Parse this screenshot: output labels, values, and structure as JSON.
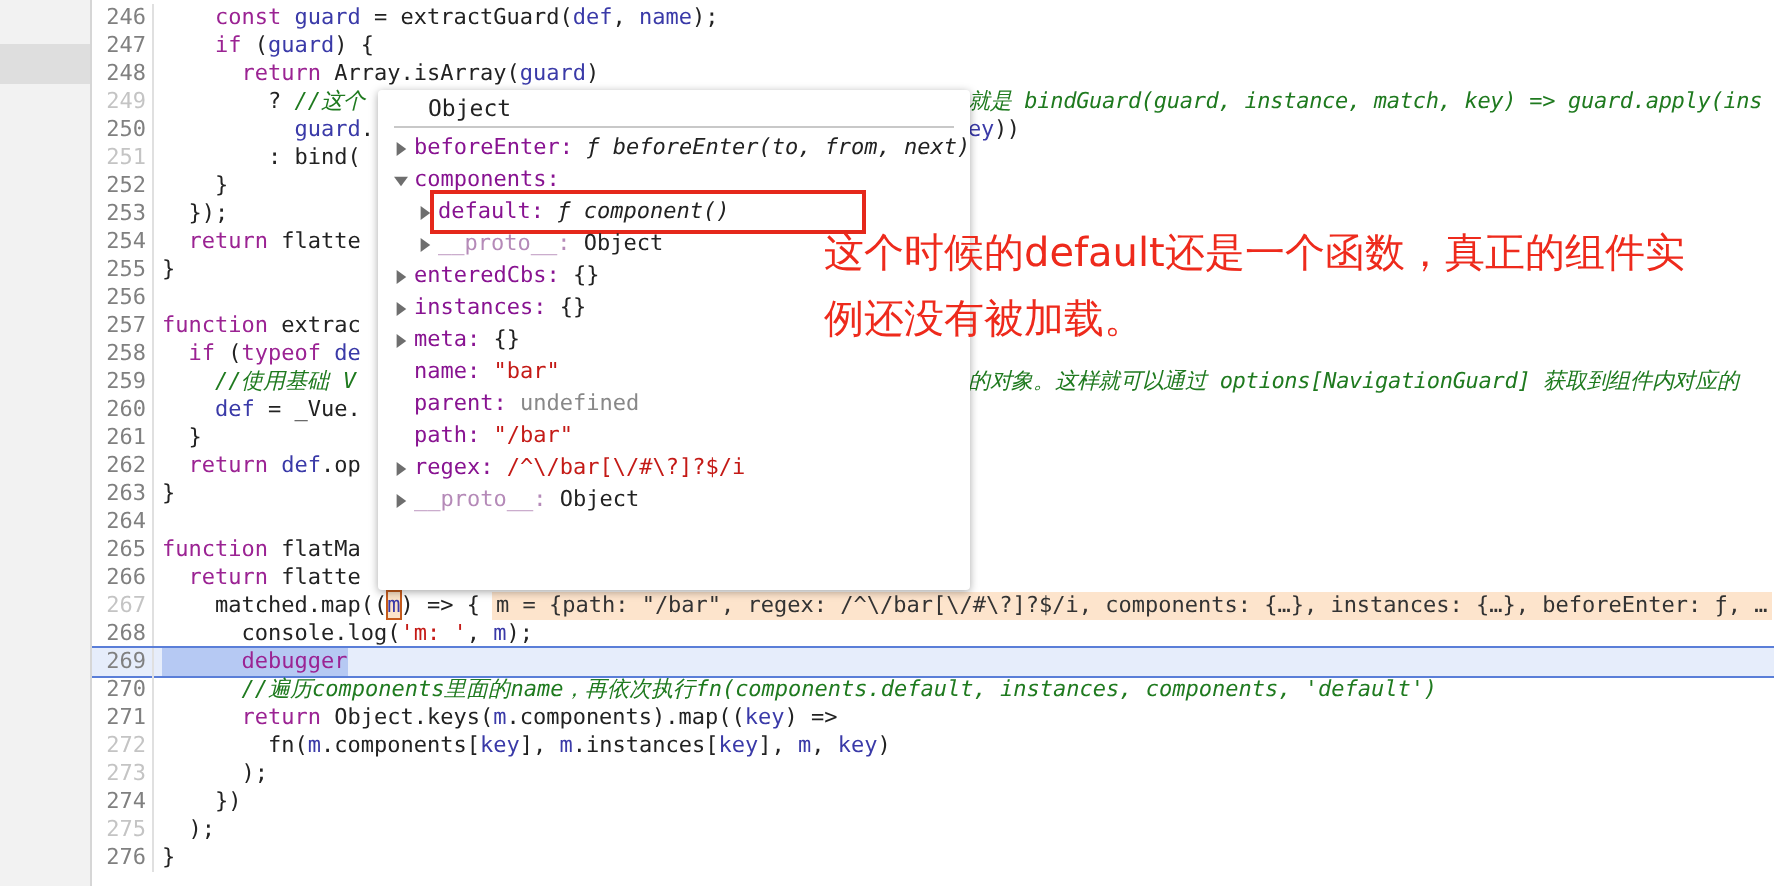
{
  "code_lines": [
    {
      "number": "246",
      "faded": false,
      "paused": false,
      "tokens": [
        {
          "kind": "keyword",
          "text": "    const"
        },
        {
          "kind": "name",
          "text": " guard"
        },
        {
          "kind": "plain",
          "text": " = extractGuard("
        },
        {
          "kind": "name",
          "text": "def"
        },
        {
          "kind": "plain",
          "text": ", "
        },
        {
          "kind": "name",
          "text": "name"
        },
        {
          "kind": "plain",
          "text": ");"
        }
      ]
    },
    {
      "number": "247",
      "faded": false,
      "paused": false,
      "tokens": [
        {
          "kind": "keyword",
          "text": "    if"
        },
        {
          "kind": "plain",
          "text": " ("
        },
        {
          "kind": "name",
          "text": "guard"
        },
        {
          "kind": "plain",
          "text": ") {"
        }
      ]
    },
    {
      "number": "248",
      "faded": false,
      "paused": false,
      "tokens": [
        {
          "kind": "keyword",
          "text": "      return"
        },
        {
          "kind": "plain",
          "text": " Array.isArray("
        },
        {
          "kind": "name",
          "text": "guard"
        },
        {
          "kind": "plain",
          "text": ")"
        }
      ]
    },
    {
      "number": "249",
      "faded": true,
      "paused": false,
      "tokens": [
        {
          "kind": "plain",
          "text": "        ? "
        },
        {
          "kind": "comment",
          "text": "//这个"
        }
      ],
      "right": [
        {
          "kind": "comment",
          "text": "就是 bindGuard(guard, instance, match, key) => guard.apply(ins"
        }
      ]
    },
    {
      "number": "250",
      "faded": false,
      "paused": false,
      "tokens": [
        {
          "kind": "name",
          "text": "          guard"
        },
        {
          "kind": "plain",
          "text": "."
        }
      ],
      "right": [
        {
          "kind": "name",
          "text": "ey"
        },
        {
          "kind": "plain",
          "text": "))"
        }
      ]
    },
    {
      "number": "251",
      "faded": true,
      "paused": false,
      "tokens": [
        {
          "kind": "plain",
          "text": "        : bind("
        }
      ]
    },
    {
      "number": "252",
      "faded": false,
      "paused": false,
      "tokens": [
        {
          "kind": "plain",
          "text": "    }"
        }
      ]
    },
    {
      "number": "253",
      "faded": false,
      "paused": false,
      "tokens": [
        {
          "kind": "plain",
          "text": "  });"
        }
      ]
    },
    {
      "number": "254",
      "faded": false,
      "paused": false,
      "tokens": [
        {
          "kind": "keyword",
          "text": "  return"
        },
        {
          "kind": "plain",
          "text": " flatte"
        }
      ]
    },
    {
      "number": "255",
      "faded": false,
      "paused": false,
      "tokens": [
        {
          "kind": "plain",
          "text": "}"
        }
      ]
    },
    {
      "number": "256",
      "faded": false,
      "paused": false
    },
    {
      "number": "257",
      "faded": false,
      "paused": false,
      "tokens": [
        {
          "kind": "keyword",
          "text": "function"
        },
        {
          "kind": "plain",
          "text": " extrac"
        }
      ]
    },
    {
      "number": "258",
      "faded": false,
      "paused": false,
      "tokens": [
        {
          "kind": "keyword",
          "text": "  if"
        },
        {
          "kind": "plain",
          "text": " ("
        },
        {
          "kind": "keyword",
          "text": "typeof"
        },
        {
          "kind": "name",
          "text": " de"
        }
      ]
    },
    {
      "number": "259",
      "faded": false,
      "paused": false,
      "tokens": [
        {
          "kind": "comment",
          "text": "    //使用基础 V"
        }
      ],
      "right": [
        {
          "kind": "comment",
          "text": "的对象。这样就可以通过 options[NavigationGuard] 获取到组件内对应的"
        }
      ]
    },
    {
      "number": "260",
      "faded": false,
      "paused": false,
      "tokens": [
        {
          "kind": "name",
          "text": "    def"
        },
        {
          "kind": "plain",
          "text": " = _Vue."
        }
      ]
    },
    {
      "number": "261",
      "faded": false,
      "paused": false,
      "tokens": [
        {
          "kind": "plain",
          "text": "  }"
        }
      ]
    },
    {
      "number": "262",
      "faded": false,
      "paused": false,
      "tokens": [
        {
          "kind": "keyword",
          "text": "  return"
        },
        {
          "kind": "name",
          "text": " def"
        },
        {
          "kind": "plain",
          "text": ".op"
        }
      ]
    },
    {
      "number": "263",
      "faded": false,
      "paused": false,
      "tokens": [
        {
          "kind": "plain",
          "text": "}"
        }
      ]
    },
    {
      "number": "264",
      "faded": false,
      "paused": false
    },
    {
      "number": "265",
      "faded": false,
      "paused": false,
      "tokens": [
        {
          "kind": "keyword",
          "text": "function"
        },
        {
          "kind": "plain",
          "text": " flatMa"
        }
      ]
    },
    {
      "number": "266",
      "faded": false,
      "paused": false,
      "tokens": [
        {
          "kind": "keyword",
          "text": "  return"
        },
        {
          "kind": "plain",
          "text": " flatte"
        }
      ]
    },
    {
      "number": "267",
      "faded": true,
      "paused": false,
      "tokens": [
        {
          "kind": "plain",
          "text": "    matched.map(("
        },
        {
          "kind": "hovered",
          "text": "m"
        },
        {
          "kind": "plain",
          "text": ") => {"
        }
      ],
      "hint": "m = {path: \"/bar\", regex: /^\\/bar[\\/#\\?]?$/i, components: {…}, instances: {…}, beforeEnter: ƒ, …"
    },
    {
      "number": "268",
      "faded": false,
      "paused": false,
      "tokens": [
        {
          "kind": "plain",
          "text": "      console.log("
        },
        {
          "kind": "string",
          "text": "'m: '"
        },
        {
          "kind": "plain",
          "text": ", "
        },
        {
          "kind": "name",
          "text": "m"
        },
        {
          "kind": "plain",
          "text": ");"
        }
      ]
    },
    {
      "number": "269",
      "faded": false,
      "paused": true,
      "tokens": [
        {
          "kind": "keyword",
          "text": "      debugger"
        }
      ]
    },
    {
      "number": "270",
      "faded": false,
      "paused": false,
      "tokens": [
        {
          "kind": "comment",
          "text": "      //遍历components里面的name，再依次执行fn(components.default, instances, components, 'default')"
        }
      ]
    },
    {
      "number": "271",
      "faded": false,
      "paused": false,
      "tokens": [
        {
          "kind": "keyword",
          "text": "      return"
        },
        {
          "kind": "plain",
          "text": " Object.keys("
        },
        {
          "kind": "name",
          "text": "m"
        },
        {
          "kind": "plain",
          "text": ".components).map(("
        },
        {
          "kind": "name",
          "text": "key"
        },
        {
          "kind": "plain",
          "text": ") =>"
        }
      ]
    },
    {
      "number": "272",
      "faded": true,
      "paused": false,
      "tokens": [
        {
          "kind": "plain",
          "text": "        fn("
        },
        {
          "kind": "name",
          "text": "m"
        },
        {
          "kind": "plain",
          "text": ".components["
        },
        {
          "kind": "name",
          "text": "key"
        },
        {
          "kind": "plain",
          "text": "], "
        },
        {
          "kind": "name",
          "text": "m"
        },
        {
          "kind": "plain",
          "text": ".instances["
        },
        {
          "kind": "name",
          "text": "key"
        },
        {
          "kind": "plain",
          "text": "], "
        },
        {
          "kind": "name",
          "text": "m"
        },
        {
          "kind": "plain",
          "text": ", "
        },
        {
          "kind": "name",
          "text": "key"
        },
        {
          "kind": "plain",
          "text": ")"
        }
      ]
    },
    {
      "number": "273",
      "faded": true,
      "paused": false,
      "tokens": [
        {
          "kind": "plain",
          "text": "      );"
        }
      ]
    },
    {
      "number": "274",
      "faded": false,
      "paused": false,
      "tokens": [
        {
          "kind": "plain",
          "text": "    })"
        }
      ]
    },
    {
      "number": "275",
      "faded": true,
      "paused": false,
      "tokens": [
        {
          "kind": "plain",
          "text": "  );"
        }
      ]
    },
    {
      "number": "276",
      "faded": false,
      "paused": false,
      "tokens": [
        {
          "kind": "plain",
          "text": "}"
        }
      ]
    }
  ],
  "popover": {
    "title": "Object",
    "items": [
      {
        "key": "beforeEnter:",
        "value": "ƒ beforeEnter(to, from, next)",
        "kind": "function",
        "expandable": true,
        "expanded": false,
        "internal": false,
        "highlighted": false
      },
      {
        "key": "components:",
        "expandable": true,
        "expanded": true,
        "internal": false,
        "highlighted": false,
        "children": [
          {
            "key": "default:",
            "value": "ƒ component()",
            "kind": "function",
            "expandable": true,
            "expanded": false,
            "internal": false,
            "highlighted": true
          },
          {
            "key": "__proto__:",
            "value": "Object",
            "kind": "plain",
            "expandable": true,
            "expanded": false,
            "internal": true,
            "highlighted": false
          }
        ]
      },
      {
        "key": "enteredCbs:",
        "value": "{}",
        "kind": "plain",
        "expandable": true,
        "expanded": false,
        "internal": false,
        "highlighted": false
      },
      {
        "key": "instances:",
        "value": "{}",
        "kind": "plain",
        "expandable": true,
        "expanded": false,
        "internal": false,
        "highlighted": false
      },
      {
        "key": "meta:",
        "value": "{}",
        "kind": "plain",
        "expandable": true,
        "expanded": false,
        "internal": false,
        "highlighted": false
      },
      {
        "key": "name:",
        "value": "\"bar\"",
        "kind": "string",
        "expandable": false,
        "internal": false,
        "highlighted": false
      },
      {
        "key": "parent:",
        "value": "undefined",
        "kind": "undefined",
        "expandable": false,
        "internal": false,
        "highlighted": false
      },
      {
        "key": "path:",
        "value": "\"/bar\"",
        "kind": "string",
        "expandable": false,
        "internal": false,
        "highlighted": false
      },
      {
        "key": "regex:",
        "value": "/^\\/bar[\\/#\\?]?$/i",
        "kind": "string",
        "expandable": true,
        "expanded": false,
        "internal": false,
        "highlighted": false
      },
      {
        "key": "__proto__:",
        "value": "Object",
        "kind": "plain",
        "expandable": true,
        "expanded": false,
        "internal": true,
        "highlighted": false
      }
    ]
  },
  "annotation": "这个时候的default还是一个函数，真正的组件实例还没有被加载。"
}
